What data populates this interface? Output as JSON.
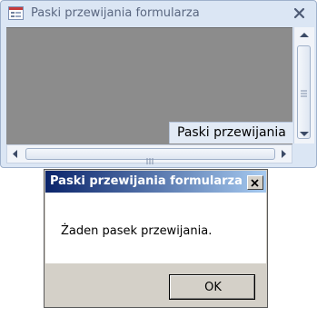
{
  "form_window": {
    "title": "Paski przewijania formularza",
    "label_text": "Paski przewijania"
  },
  "message_box": {
    "title": "Paski przewijania formularza",
    "message": "Żaden pasek przewijania.",
    "ok_label": "OK"
  },
  "icons": {
    "form_icon": "access-form-icon",
    "form_close": "close-icon",
    "msg_close": "close-icon",
    "scroll_up": "arrow-up-icon",
    "scroll_down": "arrow-down-icon",
    "scroll_left": "arrow-left-icon",
    "scroll_right": "arrow-right-icon"
  },
  "colors": {
    "form_background": "#8c8c8c",
    "msg_title_start": "#0a246a",
    "msg_title_end": "#a6caf0"
  }
}
